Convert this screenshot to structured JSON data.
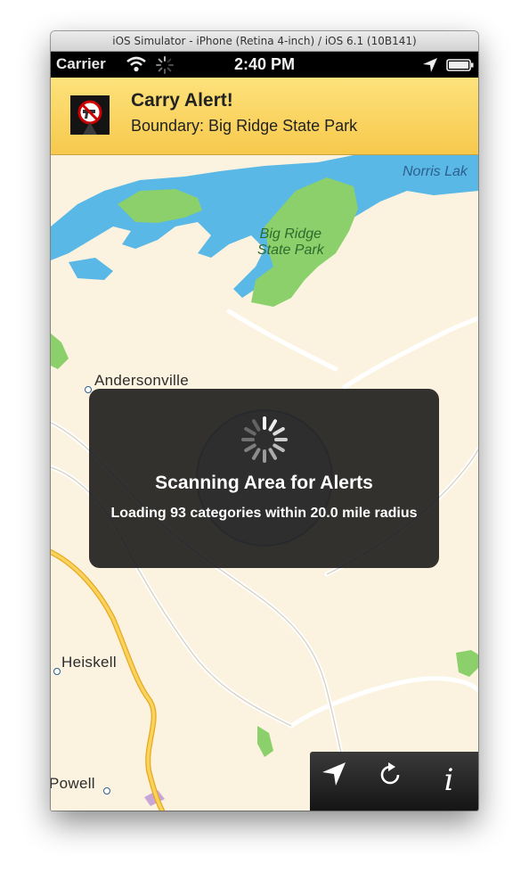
{
  "simulator": {
    "window_title": "iOS Simulator - iPhone (Retina 4-inch) / iOS 6.1 (10B141)"
  },
  "status_bar": {
    "carrier": "Carrier",
    "time": "2:40 PM"
  },
  "banner": {
    "title": "Carry Alert!",
    "subtitle": "Boundary: Big Ridge State Park",
    "icon": "no-gun-icon"
  },
  "map": {
    "labels": {
      "lake": "Norris Lak",
      "park": "Big Ridge\nState Park",
      "andersonville": "Andersonville",
      "heiskell": "Heiskell",
      "powell": "Powell"
    }
  },
  "hud": {
    "title": "Scanning Area for Alerts",
    "detail": "Loading 93 categories within 20.0 mile radius"
  },
  "toolbar": {
    "info_label": "i"
  },
  "colors": {
    "banner": "#f7c94c",
    "water": "#59b8e6",
    "park": "#8bd06a",
    "land": "#fbf3df",
    "highway": "#f6c23e"
  }
}
